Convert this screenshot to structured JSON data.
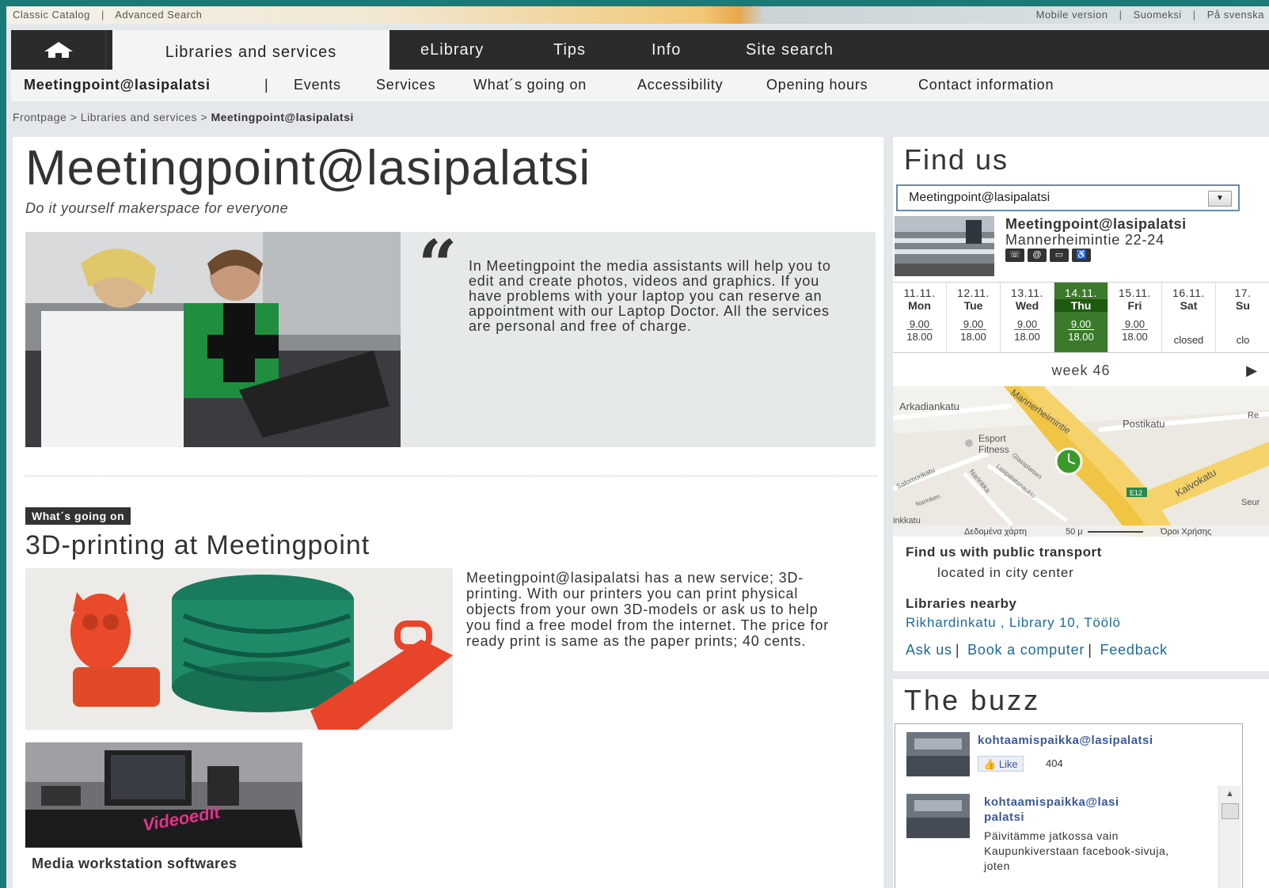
{
  "utility": {
    "classic_catalog": "Classic Catalog",
    "advanced_search": "Advanced Search",
    "mobile_version": "Mobile version",
    "finnish": "Suomeksi",
    "swedish": "På svenska",
    "separator": "|"
  },
  "nav": {
    "active": "Libraries and services",
    "items": [
      "eLibrary",
      "Tips",
      "Info",
      "Site search"
    ]
  },
  "subnav": {
    "current": "Meetingpoint@lasipalatsi",
    "separator": "|",
    "items": [
      "Events",
      "Services",
      "What´s going on",
      "Accessibility",
      "Opening hours",
      "Contact information"
    ]
  },
  "breadcrumb": {
    "home": "Frontpage",
    "section": "Libraries and services",
    "current": "Meetingpoint@lasipalatsi",
    "separator": ">"
  },
  "main": {
    "title": "Meetingpoint@lasipalatsi",
    "subtitle": "Do it yourself makerspace for everyone",
    "quote": "In Meetingpoint the media assistants will help you to edit and create photos, videos and graphics. If you have problems with your laptop you can reserve an appointment with our Laptop Doctor. All the services are personal and free of charge.",
    "tag": "What´s going on",
    "article_title": "3D-printing at Meetingpoint",
    "article_text": "Meetingpoint@lasipalatsi has a new service; 3D-printing. With our printers you can print physical objects from your own 3D-models or ask us to help you find a free model from the internet. The price for ready print is same as the paper prints; 40 cents.",
    "video_overlay": "Videoedit",
    "video_caption": "Media workstation softwares"
  },
  "find_us": {
    "heading": "Find us",
    "selected_library": "Meetingpoint@lasipalatsi",
    "library_name": "Meetingpoint@lasipalatsi",
    "address": "Mannerheimintie 22-24",
    "days": [
      {
        "date": "11.11.",
        "weekday": "Mon",
        "open": "9.00",
        "close": "18.00",
        "today": false
      },
      {
        "date": "12.11.",
        "weekday": "Tue",
        "open": "9.00",
        "close": "18.00",
        "today": false
      },
      {
        "date": "13.11.",
        "weekday": "Wed",
        "open": "9.00",
        "close": "18.00",
        "today": false
      },
      {
        "date": "14.11.",
        "weekday": "Thu",
        "open": "9.00",
        "close": "18.00",
        "today": true
      },
      {
        "date": "15.11.",
        "weekday": "Fri",
        "open": "9.00",
        "close": "18.00",
        "today": false
      },
      {
        "date": "16.11.",
        "weekday": "Sat",
        "status": "closed",
        "today": false
      },
      {
        "date": "17.",
        "weekday": "Su",
        "status": "clo",
        "today": false
      }
    ],
    "week_label": "week 46",
    "map": {
      "streets": [
        "Arkadiankatu",
        "Mannerheimintie",
        "Postikatu",
        "Kaivokatu",
        "Salomonkatu",
        "Narinkka",
        "Lasipalatsinaukio",
        "Glassplatsen",
        "Narinken"
      ],
      "poi": [
        "Esport",
        "Fitness"
      ],
      "road_shield": "E12",
      "footer_data": "Δεδομένα χάρτη",
      "footer_scale": "50 μ",
      "footer_terms": "Όροι Χρήσης",
      "edge_labels": [
        "Re",
        "Seur",
        "inkkatu"
      ]
    },
    "transport_heading": "Find us with public transport",
    "transport_text": "located in city center",
    "nearby_heading": "Libraries nearby",
    "nearby_libraries": "Rikhardinkatu , Library 10, Töölö",
    "links": [
      "Ask us",
      "Book a computer",
      "Feedback"
    ]
  },
  "buzz": {
    "heading": "The buzz",
    "page_name": "kohtaamispaikka@lasipalatsi",
    "like_label": "Like",
    "like_count": "404",
    "post_author_line1": "kohtaamispaikka@lasi",
    "post_author_line2": "palatsi",
    "post_text": "Päivitämme jatkossa vain Kaupunkiverstaan facebook-sivuja, joten"
  },
  "colors": {
    "nav_bg": "#2b2b2b",
    "today_green": "#3a7a2a",
    "link_blue": "#1a6a9a",
    "frame_teal": "#1a7a78"
  }
}
